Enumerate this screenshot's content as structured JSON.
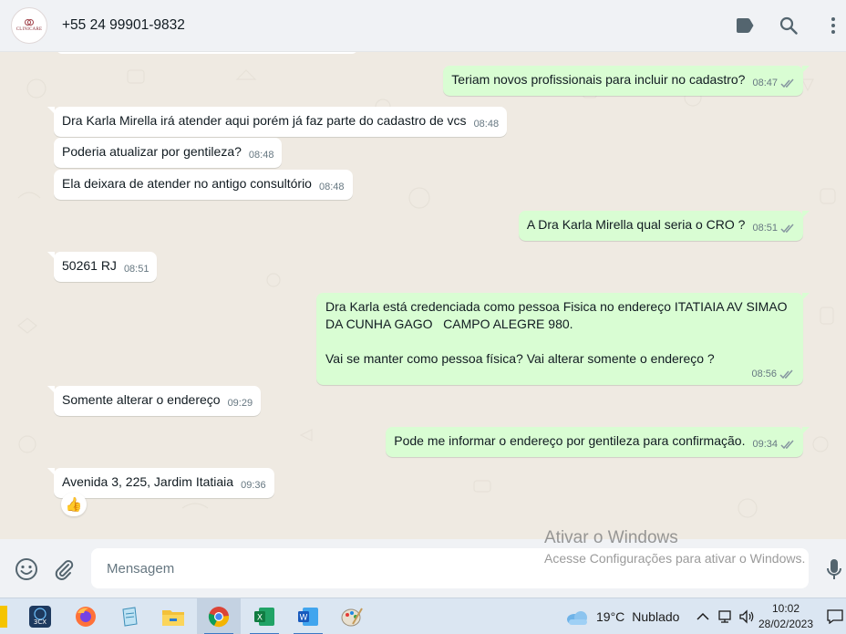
{
  "header": {
    "avatar_text": "CLINICARE",
    "contact": "+55 24 99901-9832",
    "icons": [
      "label-icon",
      "search-icon",
      "more-vertical-icon"
    ]
  },
  "messages": [
    {
      "dir": "out",
      "text": "Teriam novos profissionais para incluir no cadastro?",
      "time": "08:47",
      "read": true
    },
    {
      "dir": "in",
      "text": "Dra Karla Mirella irá atender aqui porém já faz parte do cadastro de vcs",
      "time": "08:48"
    },
    {
      "dir": "in",
      "text": "Poderia atualizar por gentileza?",
      "time": "08:48"
    },
    {
      "dir": "in",
      "text": "Ela deixara de atender no antigo consultório",
      "time": "08:48"
    },
    {
      "dir": "out",
      "text": "A Dra Karla Mirella qual seria o CRO ?",
      "time": "08:51",
      "read": true
    },
    {
      "dir": "in",
      "text": "50261 RJ",
      "time": "08:51"
    },
    {
      "dir": "out",
      "text": "Dra Karla está credenciada como pessoa Fisica no endereço ITATIAIA AV SIMAO DA CUNHA GAGO   CAMPO ALEGRE 980.\n\nVai se manter como pessoa física? Vai alterar somente o endereço ?",
      "time": "08:56",
      "read": true
    },
    {
      "dir": "in",
      "text": "Somente alterar o endereço",
      "time": "09:29"
    },
    {
      "dir": "out",
      "text": "Pode me informar o endereço por gentileza para confirmação.",
      "time": "09:34",
      "read": true
    },
    {
      "dir": "in",
      "text": "Avenida 3, 225, Jardim Itatiaia",
      "time": "09:36",
      "reaction": "👍"
    }
  ],
  "composer": {
    "placeholder": "Mensagem",
    "icons": [
      "emoji-icon",
      "attach-icon",
      "microphone-icon"
    ]
  },
  "watermark": {
    "title": "Ativar o Windows",
    "subtitle": "Acesse Configurações para ativar o Windows."
  },
  "taskbar": {
    "apps": [
      "3CX",
      "firefox-icon",
      "notepad-icon",
      "file-explorer-icon",
      "chrome-icon",
      "excel-icon",
      "word-icon",
      "paint-icon"
    ],
    "weather_temp": "19°C",
    "weather_cond": "Nublado",
    "time": "10:02",
    "date": "28/02/2023"
  },
  "colors": {
    "outgoing_bubble": "#d9fdd3",
    "incoming_bubble": "#ffffff",
    "chat_background": "#efeae2",
    "read_ticks": "#8696a0"
  }
}
